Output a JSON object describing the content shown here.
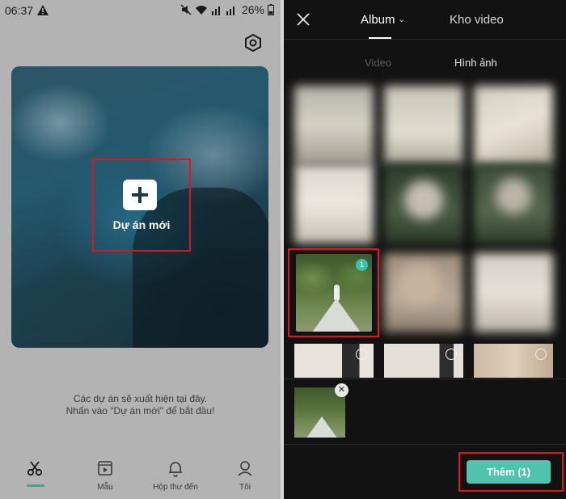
{
  "left": {
    "status": {
      "time": "06:37",
      "battery": "26%"
    },
    "new_project": {
      "label": "Dự án mới"
    },
    "hint": {
      "line1": "Các dự án sẽ xuất hiện tại đây.",
      "line2": "Nhấn vào \"Dự án mới\" để bắt đầu!"
    },
    "bottom_nav": [
      {
        "label": "",
        "icon": "scissors-icon",
        "active": true
      },
      {
        "label": "Mẫu",
        "icon": "template-icon"
      },
      {
        "label": "Hộp thư đến",
        "icon": "bell-icon"
      },
      {
        "label": "Tôi",
        "icon": "person-icon"
      }
    ]
  },
  "right": {
    "tabs": {
      "album": "Album",
      "kho_video": "Kho video"
    },
    "subtabs": {
      "video": "Video",
      "hinh_anh": "Hình ảnh"
    },
    "selected_badge": "1",
    "add_button": "Thêm (1)"
  },
  "colors": {
    "accent": "#4fc3ae",
    "highlight_red": "#e0141c",
    "picker_bg": "#121212"
  }
}
